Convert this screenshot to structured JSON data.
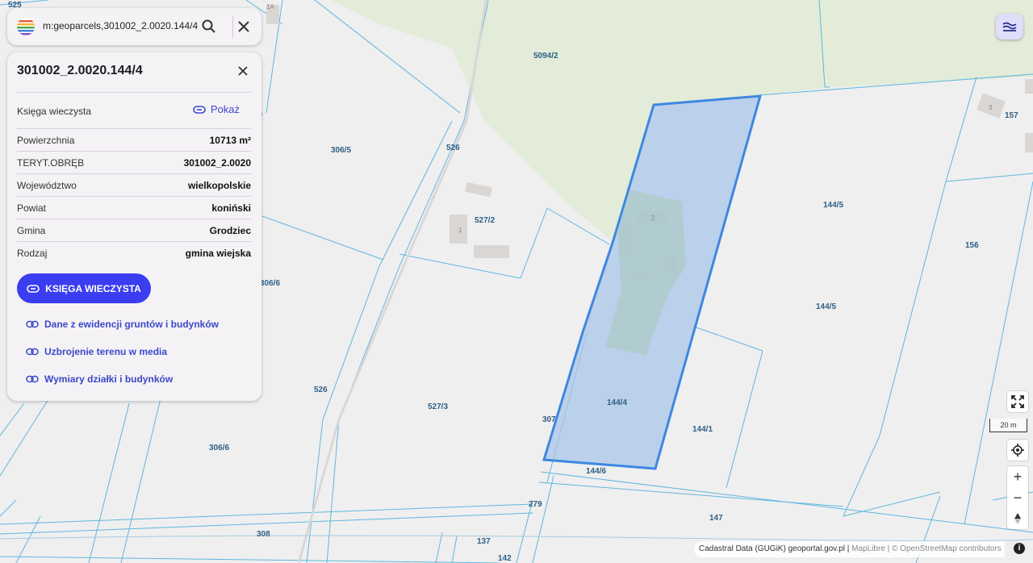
{
  "search": {
    "query": "m:geoparcels,301002_2.0020.144/4"
  },
  "panel": {
    "title": "301002_2.0020.144/4",
    "ksiega_label": "Księga wieczysta",
    "show_label": "Pokaż",
    "rows": [
      {
        "key": "Powierzchnia",
        "value": "10713 m²"
      },
      {
        "key": "TERYT.OBRĘB",
        "value": "301002_2.0020"
      },
      {
        "key": "Województwo",
        "value": "wielkopolskie"
      },
      {
        "key": "Powiat",
        "value": "koniński"
      },
      {
        "key": "Gmina",
        "value": "Grodziec"
      },
      {
        "key": "Rodzaj",
        "value": "gmina wiejska"
      }
    ],
    "button_label": "KSIĘGA WIECZYSTA",
    "links": [
      "Dane z ewidencji gruntów i budynków",
      "Uzbrojenie terenu w media",
      "Wymiary działki i budynków"
    ]
  },
  "map": {
    "parcel_labels": {
      "p525": "525",
      "p1a": "1A",
      "p5094_2": "5094/2",
      "p306_5": "306/5",
      "p526a": "526",
      "p527_2": "527/2",
      "p306_6a": "306/6",
      "p526b": "526",
      "p527_3": "527/3",
      "p307": "307",
      "p144_4": "144/4",
      "p144_6": "144/6",
      "p144_1": "144/1",
      "p144_5a": "144/5",
      "p144_5b": "144/5",
      "p157": "157",
      "p156": "156",
      "p306_6b": "306/6",
      "p279": "279",
      "p147": "147",
      "p308": "308",
      "p137": "137",
      "p142": "142"
    },
    "building_labels": {
      "b1": "1",
      "b2": "2",
      "b3": "3"
    },
    "colors": {
      "background": "#efefef",
      "forest": "#e2ecd8",
      "parcel_lines": "#5fb6e0",
      "selected_fill": "#a9c5e9",
      "selected_stroke": "#3d88e0",
      "button": "#3a3df0",
      "link": "#3b48c8"
    }
  },
  "controls": {
    "scale_label": "20 m",
    "zoom_in": "+",
    "zoom_out": "−"
  },
  "attribution": {
    "source": "Cadastral Data (GUGiK) geoportal.gov.pl",
    "sep1": " | ",
    "maplibre": "MapLibre",
    "osm_text": " | © OpenStreetMap contributors",
    "info": "i"
  }
}
